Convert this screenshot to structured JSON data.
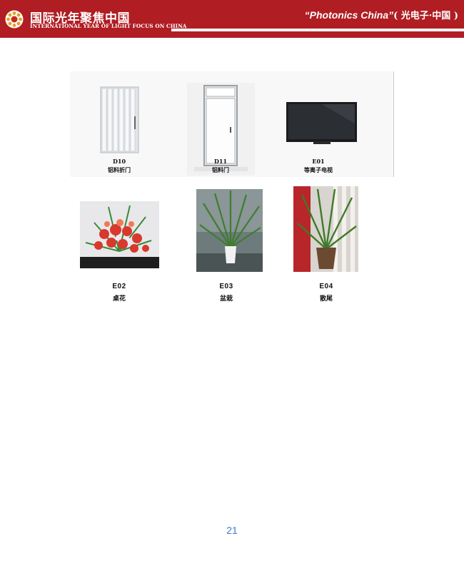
{
  "header": {
    "title_cn": "国际光年聚焦中国",
    "title_en": "INTERNATIONAL YEAR OF LIGHT FOCUS ON CHINA",
    "brand_en": "“Photonics China”",
    "brand_cn": "( 光电子·中国 )",
    "color": "#b01d23"
  },
  "items": [
    {
      "code": "D10",
      "name": "铝料折门"
    },
    {
      "code": "D11",
      "name": "铝料门"
    },
    {
      "code": "E01",
      "name": "等离子电视"
    },
    {
      "code": "E02",
      "name": "桌花"
    },
    {
      "code": "E03",
      "name": "盆栽"
    },
    {
      "code": "E04",
      "name": "散尾"
    }
  ],
  "page_number": "21"
}
